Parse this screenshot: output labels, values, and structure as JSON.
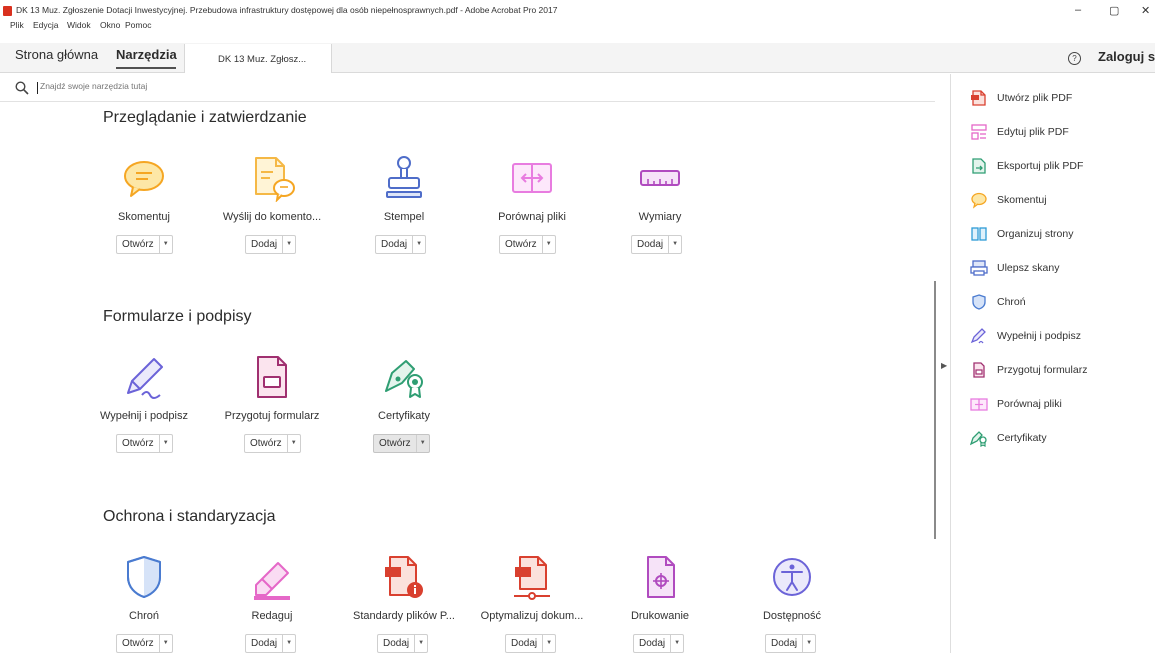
{
  "window": {
    "title": "DK 13 Muz. Zgłoszenie Dotacji Inwestycyjnej. Przebudowa infrastruktury dostępowej dla osób niepełnosprawnych.pdf - Adobe Acrobat Pro 2017",
    "minimize": "–",
    "maximize": "▢",
    "close": "✕"
  },
  "menu": [
    "Plik",
    "Edycja",
    "Widok",
    "Okno",
    "Pomoc"
  ],
  "tabs": {
    "home": "Strona główna",
    "tools": "Narzędzia",
    "document": "DK 13 Muz. Zgłosz..."
  },
  "header": {
    "help": "?",
    "login": "Zaloguj si"
  },
  "search": {
    "placeholder": "Znajdź swoje narzędzia tutaj"
  },
  "sections": [
    {
      "title": "Przeglądanie i zatwierdzanie",
      "tools": [
        {
          "name": "Skomentuj",
          "button": "Otwórz",
          "icon": "comment-icon"
        },
        {
          "name": "Wyślij do komento...",
          "button": "Dodaj",
          "icon": "send-for-comments-icon"
        },
        {
          "name": "Stempel",
          "button": "Dodaj",
          "icon": "stamp-icon"
        },
        {
          "name": "Porównaj pliki",
          "button": "Otwórz",
          "icon": "compare-files-icon"
        },
        {
          "name": "Wymiary",
          "button": "Dodaj",
          "icon": "measure-icon"
        }
      ]
    },
    {
      "title": "Formularze i podpisy",
      "tools": [
        {
          "name": "Wypełnij i podpisz",
          "button": "Otwórz",
          "icon": "fill-sign-icon"
        },
        {
          "name": "Przygotuj formularz",
          "button": "Otwórz",
          "icon": "prepare-form-icon"
        },
        {
          "name": "Certyfikaty",
          "button": "Otwórz",
          "icon": "certificates-icon"
        }
      ]
    },
    {
      "title": "Ochrona i standaryzacja",
      "tools": [
        {
          "name": "Chroń",
          "button": "Otwórz",
          "icon": "protect-icon"
        },
        {
          "name": "Redaguj",
          "button": "Dodaj",
          "icon": "redact-icon"
        },
        {
          "name": "Standardy plików P...",
          "button": "Dodaj",
          "icon": "pdf-standards-icon"
        },
        {
          "name": "Optymalizuj dokum...",
          "button": "Dodaj",
          "icon": "optimize-pdf-icon"
        },
        {
          "name": "Drukowanie",
          "button": "Dodaj",
          "icon": "print-production-icon"
        },
        {
          "name": "Dostępność",
          "button": "Dodaj",
          "icon": "accessibility-icon"
        }
      ]
    }
  ],
  "right_pane": [
    {
      "label": "Utwórz plik PDF",
      "icon": "create-pdf-icon"
    },
    {
      "label": "Edytuj plik PDF",
      "icon": "edit-pdf-icon"
    },
    {
      "label": "Eksportuj plik PDF",
      "icon": "export-pdf-icon"
    },
    {
      "label": "Skomentuj",
      "icon": "comment-icon"
    },
    {
      "label": "Organizuj strony",
      "icon": "organize-pages-icon"
    },
    {
      "label": "Ulepsz skany",
      "icon": "enhance-scans-icon"
    },
    {
      "label": "Chroń",
      "icon": "protect-icon"
    },
    {
      "label": "Wypełnij i podpisz",
      "icon": "fill-sign-icon"
    },
    {
      "label": "Przygotuj formularz",
      "icon": "prepare-form-icon"
    },
    {
      "label": "Porównaj pliki",
      "icon": "compare-files-icon"
    },
    {
      "label": "Certyfikaty",
      "icon": "certificates-icon"
    }
  ],
  "colors": {
    "comment": "#f5a623",
    "stamp": "#4f6dc9",
    "compare": "#e87ce0",
    "measure": "#b04bbf",
    "form": "#a03070",
    "cert": "#2f9e73",
    "protect": "#4a7bd0",
    "redact": "#e568c8",
    "pdf_red": "#d9402f",
    "accessibility": "#6b63d8"
  }
}
